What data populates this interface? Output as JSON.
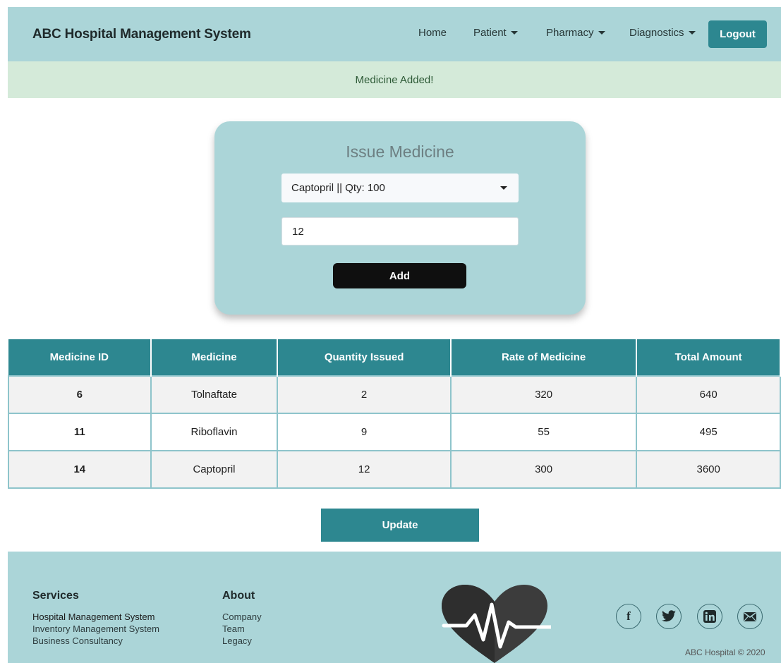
{
  "header": {
    "brand": "ABC Hospital Management System",
    "nav": {
      "home": "Home",
      "patient": "Patient",
      "pharmacy": "Pharmacy",
      "diagnostics": "Diagnostics",
      "logout": "Logout"
    }
  },
  "alert": {
    "message": "Medicine Added!"
  },
  "issue_form": {
    "title": "Issue Medicine",
    "selected_medicine": "Captopril || Qty: 100",
    "quantity_value": "12",
    "add_label": "Add"
  },
  "table": {
    "headers": [
      "Medicine ID",
      "Medicine",
      "Quantity Issued",
      "Rate of Medicine",
      "Total Amount"
    ],
    "rows": [
      [
        "6",
        "Tolnaftate",
        "2",
        "320",
        "640"
      ],
      [
        "11",
        "Riboflavin",
        "9",
        "55",
        "495"
      ],
      [
        "14",
        "Captopril",
        "12",
        "300",
        "3600"
      ]
    ]
  },
  "update_label": "Update",
  "footer": {
    "services": {
      "title": "Services",
      "links": [
        "Hospital Management System",
        "Inventory Management System",
        "Business Consultancy"
      ]
    },
    "about": {
      "title": "About",
      "links": [
        "Company",
        "Team",
        "Legacy"
      ]
    },
    "social_icons": [
      "facebook-icon",
      "twitter-icon",
      "linkedin-icon",
      "mail-icon"
    ],
    "copyright": "ABC Hospital © 2020"
  },
  "colors": {
    "navbar_bg": "#abd5d8",
    "accent": "#2d8790",
    "alert_bg": "#d4ead9"
  }
}
